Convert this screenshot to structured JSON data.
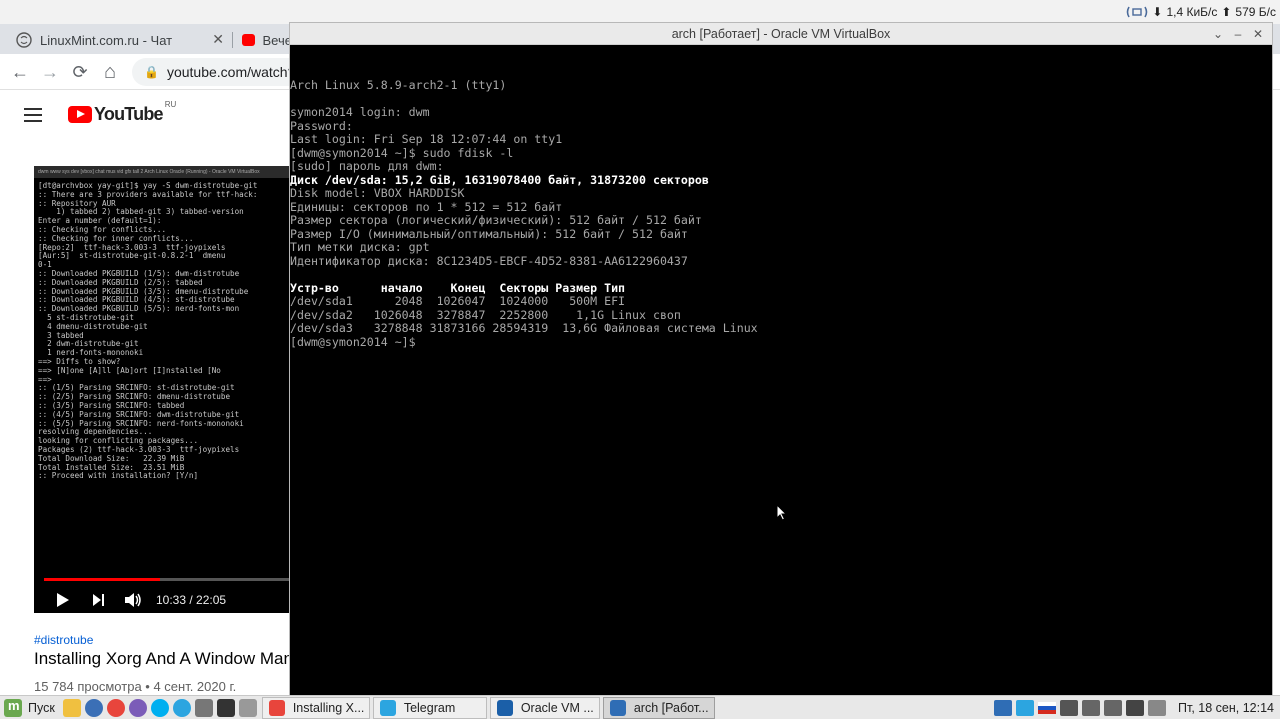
{
  "system_indicators": {
    "down_rate": "1,4 КиБ/с",
    "up_rate": "579 Б/с",
    "colors": {
      "net_icon": "#4a6a9a"
    }
  },
  "browser": {
    "tabs": [
      {
        "title": "LinuxMint.com.ru - Чат",
        "favicon": "linuxmint-icon",
        "close": "✕"
      },
      {
        "title": "Вече",
        "favicon": "youtube-icon"
      }
    ],
    "nav": {
      "back": "←",
      "forward": "→",
      "reload": "⟳",
      "home": "⌂",
      "url": "youtube.com/watch?"
    },
    "youtube": {
      "logo_text": "YouTube",
      "region": "RU",
      "video": {
        "titlebar": "dwm  www  sys  dev  [vbox]  chat  mus  vid  gfx    tall  2    Arch Linux Oracle (Running) - Oracle VM VirtualBox",
        "terminal_lines": [
          "[dt@archvbox yay-git]$ yay -S dwm-distrotube-git",
          ":: There are 3 providers available for ttf-hack:",
          ":: Repository AUR",
          "    1) tabbed 2) tabbed-git 3) tabbed-version",
          "",
          "Enter a number (default=1):",
          ":: Checking for conflicts...",
          ":: Checking for inner conflicts...",
          "[Repo:2]  ttf-hack-3.003-3  ttf-joypixels",
          "[Aur:5]  st-distrotube-git-0.8.2-1  dmenu",
          "0-1",
          "",
          ":: Downloaded PKGBUILD (1/5): dwm-distrotube",
          ":: Downloaded PKGBUILD (2/5): tabbed",
          ":: Downloaded PKGBUILD (3/5): dmenu-distrotube",
          ":: Downloaded PKGBUILD (4/5): st-distrotube",
          ":: Downloaded PKGBUILD (5/5): nerd-fonts-mon",
          "  5 st-distrotube-git",
          "  4 dmenu-distrotube-git",
          "  3 tabbed",
          "  2 dwm-distrotube-git",
          "  1 nerd-fonts-mononoki",
          "==> Diffs to show?",
          "==> [N]one [A]ll [Ab]ort [I]nstalled [No",
          "==>",
          ":: (1/5) Parsing SRCINFO: st-distrotube-git",
          ":: (2/5) Parsing SRCINFO: dmenu-distrotube",
          ":: (3/5) Parsing SRCINFO: tabbed",
          ":: (4/5) Parsing SRCINFO: dwm-distrotube-git",
          ":: (5/5) Parsing SRCINFO: nerd-fonts-mononoki",
          "resolving dependencies...",
          "looking for conflicting packages...",
          "",
          "Packages (2) ttf-hack-3.003-3  ttf-joypixels",
          "",
          "Total Download Size:   22.39 MiB",
          "Total Installed Size:  23.51 MiB",
          "",
          ":: Proceed with installation? [Y/n]"
        ],
        "progress_fraction": 0.47,
        "time": "10:33 / 22:05"
      },
      "hashtag": "#distrotube",
      "title": "Installing Xorg And A Window Manager In Arch Linux",
      "meta": "15 784 просмотра • 4 сент. 2020 г."
    }
  },
  "vbox": {
    "title": "arch [Работает] - Oracle VM VirtualBox",
    "buttons": {
      "menu": "⌄",
      "minimize": "–",
      "maximize": "+",
      "close": "✕"
    },
    "console": [
      {
        "text": "Arch Linux 5.8.9-arch2-1 (tty1)",
        "bright": false
      },
      {
        "text": "",
        "bright": false
      },
      {
        "text": "symon2014 login: dwm",
        "bright": false
      },
      {
        "text": "Password:",
        "bright": false
      },
      {
        "text": "Last login: Fri Sep 18 12:07:44 on tty1",
        "bright": false
      },
      {
        "text": "[dwm@symon2014 ~]$ sudo fdisk -l",
        "bright": false
      },
      {
        "text": "[sudo] пароль для dwm:",
        "bright": false
      },
      {
        "text": "Диск /dev/sda: 15,2 GiB, 16319078400 байт, 31873200 секторов",
        "bright": true
      },
      {
        "text": "Disk model: VBOX HARDDISK",
        "bright": false
      },
      {
        "text": "Единицы: секторов по 1 * 512 = 512 байт",
        "bright": false
      },
      {
        "text": "Размер сектора (логический/физический): 512 байт / 512 байт",
        "bright": false
      },
      {
        "text": "Размер I/O (минимальный/оптимальный): 512 байт / 512 байт",
        "bright": false
      },
      {
        "text": "Тип метки диска: gpt",
        "bright": false
      },
      {
        "text": "Идентификатор диска: 8C1234D5-EBCF-4D52-8381-AA6122960437",
        "bright": false
      },
      {
        "text": "",
        "bright": false
      },
      {
        "text": "Устр-во      начало    Конец  Секторы Размер Тип",
        "bright": true
      },
      {
        "text": "/dev/sda1      2048  1026047  1024000   500M EFI",
        "bright": false
      },
      {
        "text": "/dev/sda2   1026048  3278847  2252800    1,1G Linux своп",
        "bright": false
      },
      {
        "text": "/dev/sda3   3278848 31873166 28594319  13,6G Файловая система Linux",
        "bright": false
      },
      {
        "text": "[dwm@symon2014 ~]$",
        "bright": false
      }
    ]
  },
  "taskbar": {
    "start_label": "Пуск",
    "tasks": [
      {
        "label": "Installing X...",
        "icon": "chrome-icon",
        "icon_color": "#e8453c",
        "active": false
      },
      {
        "label": "Telegram",
        "icon": "telegram-icon",
        "icon_color": "#2ca5e0",
        "active": false
      },
      {
        "label": "Oracle VM ...",
        "icon": "virtualbox-icon",
        "icon_color": "#1b5fa8",
        "active": false
      },
      {
        "label": "arch [Работ...",
        "icon": "vbox-vm-icon",
        "icon_color": "#2f6db5",
        "active": true
      }
    ],
    "clock": "Пт, 18 сен, 12:14"
  }
}
